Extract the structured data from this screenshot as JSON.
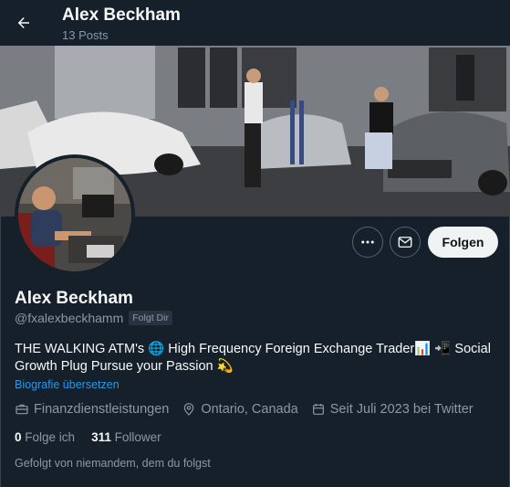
{
  "topbar": {
    "title": "Alex Beckham",
    "post_count": "13 Posts"
  },
  "profile": {
    "name": "Alex Beckham",
    "handle": "@fxalexbeckhamm",
    "follows_you_badge": "Folgt Dir",
    "bio_text": "THE WALKING ATM's 🌐 High Frequency Foreign Exchange Trader📊 📲 Social Growth Plug Pursue your Passion 💫",
    "translate_link": "Biografie übersetzen",
    "category": "Finanzdienstleistungen",
    "location": "Ontario, Canada",
    "joined": "Seit Juli 2023 bei Twitter",
    "following_count": "0",
    "following_label": "Folge ich",
    "followers_count": "311",
    "followers_label": "Follower",
    "followed_by": "Gefolgt von niemandem, dem du folgst"
  },
  "actions": {
    "follow_label": "Folgen",
    "more_icon": "more-dots-icon",
    "message_icon": "envelope-icon"
  },
  "colors": {
    "background": "#15202b",
    "accent": "#1d9bf0",
    "secondary_text": "#8b98a5",
    "follow_button_bg": "#eff3f4"
  }
}
